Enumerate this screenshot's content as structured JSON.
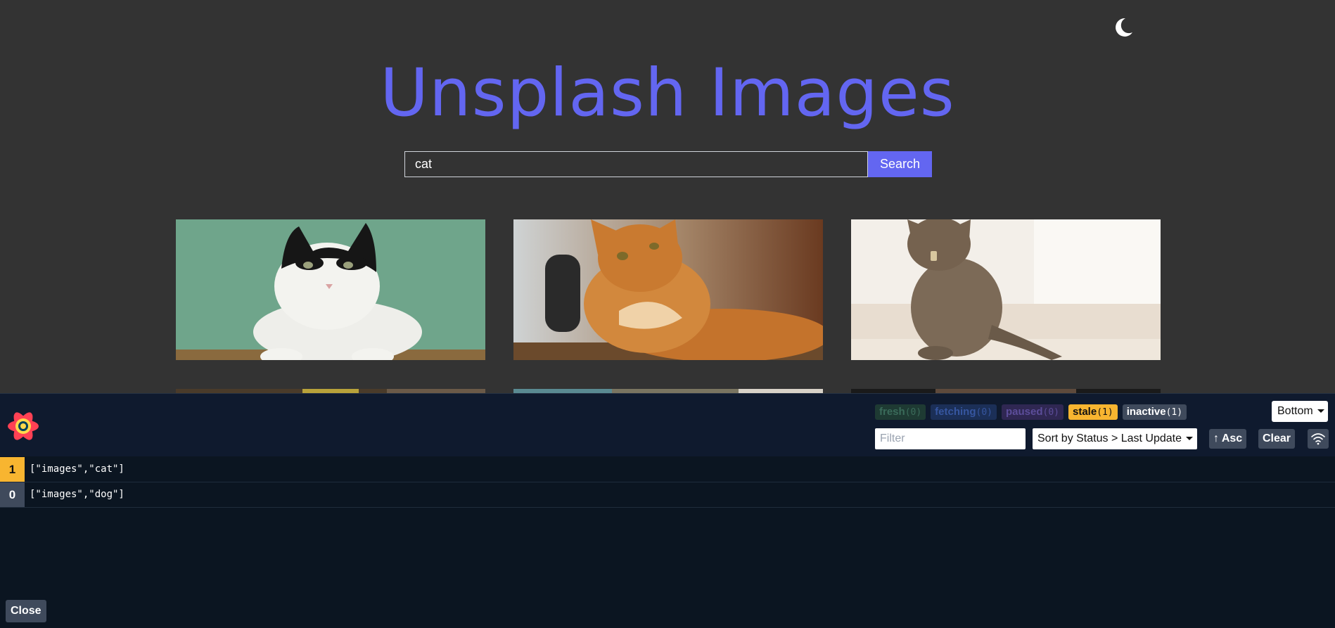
{
  "app": {
    "title": "Unsplash Images",
    "search": {
      "value": "cat",
      "button_label": "Search"
    },
    "theme_icon": "moon-icon",
    "images": [
      {
        "name": "cat-image-1"
      },
      {
        "name": "cat-image-2"
      },
      {
        "name": "cat-image-3"
      }
    ]
  },
  "devtools": {
    "logo_icon": "react-query-logo-icon",
    "badges": {
      "fresh": {
        "label": "fresh",
        "count": "(0)"
      },
      "fetching": {
        "label": "fetching",
        "count": "(0)"
      },
      "paused": {
        "label": "paused",
        "count": "(0)"
      },
      "stale": {
        "label": "stale",
        "count": "(1)"
      },
      "inactive": {
        "label": "inactive",
        "count": "(1)"
      }
    },
    "position_select": "Bottom",
    "filter_placeholder": "Filter",
    "sort_select": "Sort by Status > Last Update",
    "asc_button": "↑ Asc",
    "clear_button": "Clear",
    "network_icon": "wifi-icon",
    "queries": [
      {
        "count": "1",
        "key": "[\"images\",\"cat\"]",
        "status": "stale"
      },
      {
        "count": "0",
        "key": "[\"images\",\"dog\"]",
        "status": "inactive"
      }
    ],
    "close_button": "Close"
  },
  "colors": {
    "page_bg": "#333333",
    "accent": "#6366f1",
    "devtools_bg": "#0b1521",
    "stale": "#f8b530",
    "inactive": "#3f4a5c"
  }
}
